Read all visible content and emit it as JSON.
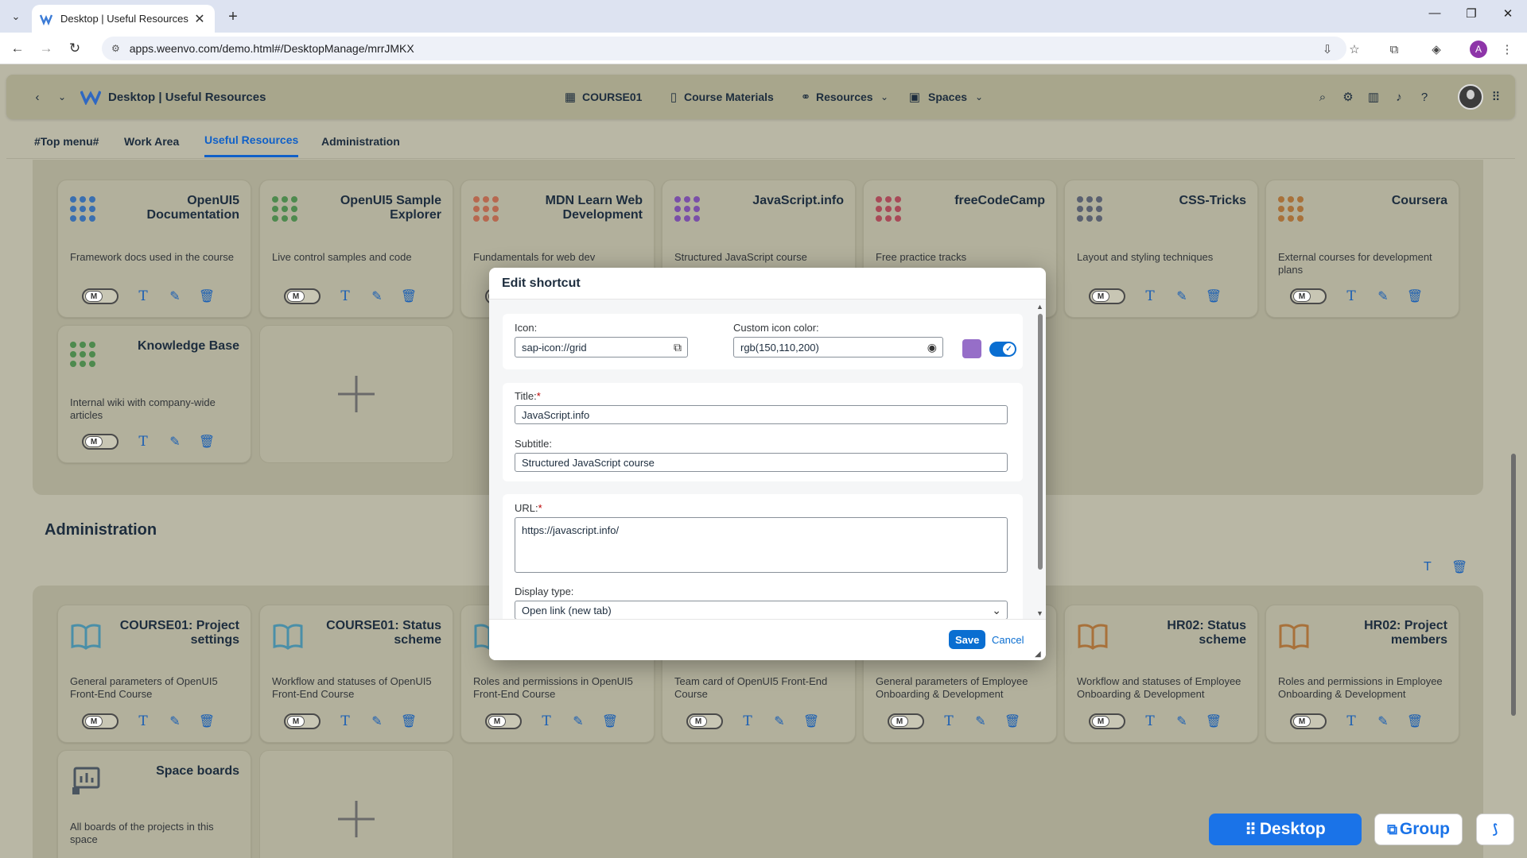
{
  "browser": {
    "tab_title": "Desktop | Useful Resources",
    "url": "apps.weenvo.com/demo.html#/DesktopManage/mrrJMKX",
    "profile_initial": "A"
  },
  "shell": {
    "title": "Desktop | Useful Resources",
    "nav": {
      "course": "COURSE01",
      "materials": "Course Materials",
      "resources": "Resources",
      "spaces": "Spaces"
    }
  },
  "tabs": [
    "#Top menu#",
    "Work Area",
    "Useful Resources",
    "Administration"
  ],
  "toggle_label": "M",
  "resources_cards": [
    {
      "title": "OpenUI5 Documentation",
      "subtitle": "Framework docs used in the course",
      "color": "#3a6fb0"
    },
    {
      "title": "OpenUI5 Sample Explorer",
      "subtitle": "Live control samples and code",
      "color": "#4e8a4e"
    },
    {
      "title": "MDN Learn Web Development",
      "subtitle": "Fundamentals for web dev",
      "color": "#b7684f"
    },
    {
      "title": "JavaScript.info",
      "subtitle": "Structured JavaScript course",
      "color": "#7a4fa8"
    },
    {
      "title": "freeCodeCamp",
      "subtitle": "Free practice tracks",
      "color": "#a84a58"
    },
    {
      "title": "CSS-Tricks",
      "subtitle": "Layout and styling techniques",
      "color": "#5a6070"
    },
    {
      "title": "Coursera",
      "subtitle": "External courses for development plans",
      "color": "#a8713a"
    },
    {
      "title": "Knowledge Base",
      "subtitle": "Internal wiki with company-wide articles",
      "color": "#4e8a4e"
    }
  ],
  "admin_section_title": "Administration",
  "admin_cards": [
    {
      "title": "COURSE01: Project settings",
      "subtitle": "General parameters of OpenUI5 Front-End Course",
      "color": "#4a8fa8"
    },
    {
      "title": "COURSE01: Status scheme",
      "subtitle": "Workflow and statuses of OpenUI5 Front-End Course",
      "color": "#4a8fa8"
    },
    {
      "title": "",
      "subtitle": "Roles and permissions in OpenUI5 Front-End Course",
      "color": "#4a8fa8"
    },
    {
      "title": "",
      "subtitle": "Team card of OpenUI5 Front-End Course",
      "color": "#4a8fa8"
    },
    {
      "title": "",
      "subtitle": "General parameters of Employee Onboarding & Development",
      "color": "#a8713a"
    },
    {
      "title": "HR02: Status scheme",
      "subtitle": "Workflow and statuses of Employee Onboarding & Development",
      "color": "#a8713a"
    },
    {
      "title": "HR02: Project members",
      "subtitle": "Roles and permissions in Employee Onboarding & Development",
      "color": "#a8713a"
    },
    {
      "title": "Space boards",
      "subtitle": "All boards of the projects in this space",
      "color": "#4a5560"
    }
  ],
  "modal": {
    "title": "Edit shortcut",
    "icon_label": "Icon:",
    "icon_value": "sap-icon://grid",
    "color_label": "Custom icon color:",
    "color_value": "rgb(150,110,200)",
    "title_label": "Title:",
    "title_value": "JavaScript.info",
    "subtitle_label": "Subtitle:",
    "subtitle_value": "Structured JavaScript course",
    "url_label": "URL:",
    "url_value": "https://javascript.info/",
    "display_label": "Display type:",
    "display_value": "Open link (new tab)",
    "save": "Save",
    "cancel": "Cancel"
  },
  "float": {
    "desktop": "Desktop",
    "group": "Group"
  }
}
